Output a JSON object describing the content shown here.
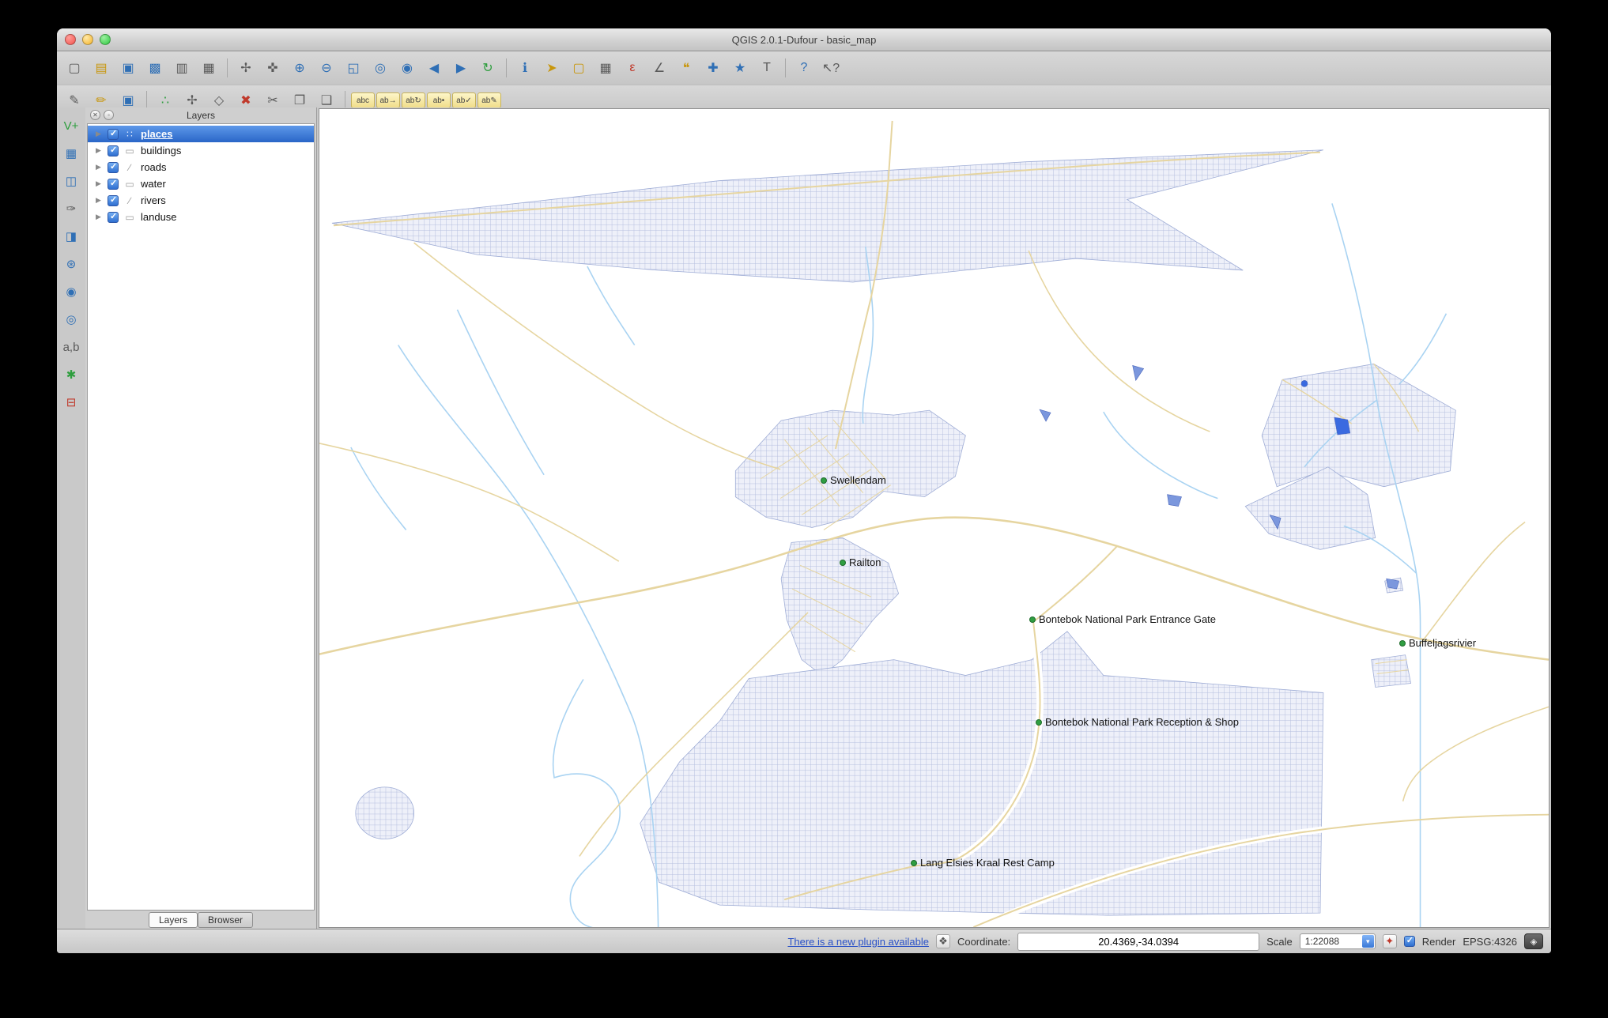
{
  "window": {
    "title": "QGIS 2.0.1-Dufour - basic_map"
  },
  "toolbars": {
    "main": [
      {
        "name": "new-project",
        "glyph": "▢"
      },
      {
        "name": "open-project",
        "glyph": "▤"
      },
      {
        "name": "save-project",
        "glyph": "▣"
      },
      {
        "name": "save-project-as",
        "glyph": "▩"
      },
      {
        "name": "new-print-composer",
        "glyph": "▥"
      },
      {
        "name": "composer-manager",
        "glyph": "▦"
      },
      {
        "name": "pan-map",
        "glyph": "✢"
      },
      {
        "name": "pan-to-selection",
        "glyph": "✜"
      },
      {
        "name": "zoom-in",
        "glyph": "⊕"
      },
      {
        "name": "zoom-out",
        "glyph": "⊖"
      },
      {
        "name": "zoom-full",
        "glyph": "◱"
      },
      {
        "name": "zoom-to-selection",
        "glyph": "◎"
      },
      {
        "name": "zoom-to-layer",
        "glyph": "◉"
      },
      {
        "name": "zoom-last",
        "glyph": "◀"
      },
      {
        "name": "zoom-next",
        "glyph": "▶"
      },
      {
        "name": "refresh",
        "glyph": "↻"
      },
      {
        "name": "identify-features",
        "glyph": "ℹ"
      },
      {
        "name": "select-features",
        "glyph": "➤"
      },
      {
        "name": "deselect-features",
        "glyph": "▢"
      },
      {
        "name": "open-attribute-table",
        "glyph": "▦"
      },
      {
        "name": "field-calculator",
        "glyph": "ε"
      },
      {
        "name": "measure-line",
        "glyph": "∠"
      },
      {
        "name": "map-tips",
        "glyph": "❝"
      },
      {
        "name": "new-bookmark",
        "glyph": "✚"
      },
      {
        "name": "show-bookmarks",
        "glyph": "★"
      },
      {
        "name": "text-annotation",
        "glyph": "T"
      },
      {
        "name": "help-contents",
        "glyph": "?"
      },
      {
        "name": "whats-this",
        "glyph": "↖?"
      }
    ],
    "digitizing": [
      {
        "name": "current-edits",
        "glyph": "✎"
      },
      {
        "name": "toggle-editing",
        "glyph": "✏"
      },
      {
        "name": "save-layer-edits",
        "glyph": "▣"
      },
      {
        "name": "add-feature",
        "glyph": "∴"
      },
      {
        "name": "move-feature",
        "glyph": "✢"
      },
      {
        "name": "node-tool",
        "glyph": "◇"
      },
      {
        "name": "delete-selected",
        "glyph": "✖"
      },
      {
        "name": "cut-features",
        "glyph": "✂"
      },
      {
        "name": "copy-features",
        "glyph": "❐"
      },
      {
        "name": "paste-features",
        "glyph": "❑"
      },
      {
        "name": "labeling-options",
        "glyph": "abc"
      },
      {
        "name": "label-move",
        "glyph": "ab→"
      },
      {
        "name": "label-rotate",
        "glyph": "ab↻"
      },
      {
        "name": "label-pin",
        "glyph": "ab•"
      },
      {
        "name": "label-show-hide",
        "glyph": "ab✓"
      },
      {
        "name": "label-properties",
        "glyph": "ab✎"
      }
    ],
    "manage_layers": [
      {
        "name": "add-vector-layer",
        "glyph": "V+"
      },
      {
        "name": "add-raster-layer",
        "glyph": "▦"
      },
      {
        "name": "add-database-layer",
        "glyph": "◫"
      },
      {
        "name": "add-spatialite-layer",
        "glyph": "✑"
      },
      {
        "name": "add-mssql-layer",
        "glyph": "◨"
      },
      {
        "name": "add-wms-layer",
        "glyph": "⊛"
      },
      {
        "name": "add-wcs-layer",
        "glyph": "◉"
      },
      {
        "name": "add-wfs-layer",
        "glyph": "◎"
      },
      {
        "name": "add-delimited-text-layer",
        "glyph": "a,b"
      },
      {
        "name": "new-shapefile-layer",
        "glyph": "✱"
      },
      {
        "name": "remove-layer",
        "glyph": "⊟"
      }
    ]
  },
  "layers_panel": {
    "title": "Layers",
    "buttons": [
      {
        "name": "close-panel",
        "glyph": "✕"
      },
      {
        "name": "detach-panel",
        "glyph": "◦"
      }
    ],
    "items": [
      {
        "label": "places",
        "glyph": "∷",
        "checked": true,
        "selected": true
      },
      {
        "label": "buildings",
        "glyph": "▭",
        "checked": true,
        "selected": false
      },
      {
        "label": "roads",
        "glyph": "∕",
        "checked": true,
        "selected": false
      },
      {
        "label": "water",
        "glyph": "▭",
        "checked": true,
        "selected": false
      },
      {
        "label": "rivers",
        "glyph": "∕",
        "checked": true,
        "selected": false
      },
      {
        "label": "landuse",
        "glyph": "▭",
        "checked": true,
        "selected": false
      }
    ],
    "tabs": [
      {
        "label": "Layers",
        "active": true
      },
      {
        "label": "Browser",
        "active": false
      }
    ]
  },
  "map": {
    "place_labels": [
      {
        "text": "Swellendam"
      },
      {
        "text": "Railton"
      },
      {
        "text": "Bontebok National Park Entrance Gate"
      },
      {
        "text": "Buffeljagsrivier"
      },
      {
        "text": "Bontebok National Park Reception & Shop"
      },
      {
        "text": "Lang Elsies Kraal Rest Camp"
      }
    ],
    "colors": {
      "landuse_fill": "#eef0f9",
      "landuse_hatch": "#b6bfdf",
      "landuse_border": "#9fadd6",
      "road": "#e6d5a0",
      "river": "#a9d3f2",
      "water": "#7b97dd",
      "water_border": "#4a66bb",
      "place_dot": "#2f9e41"
    }
  },
  "status_bar": {
    "plugin_link": "There is a new plugin available",
    "plugin_icon_glyph": "❖",
    "coordinate_label": "Coordinate:",
    "coordinate_value": "20.4369,-34.0394",
    "scale_label": "Scale",
    "scale_value": "1:22088",
    "stop_render_glyph": "✦",
    "render_label": "Render",
    "crs_label": "EPSG:4326",
    "crs_button_glyph": "◈"
  }
}
